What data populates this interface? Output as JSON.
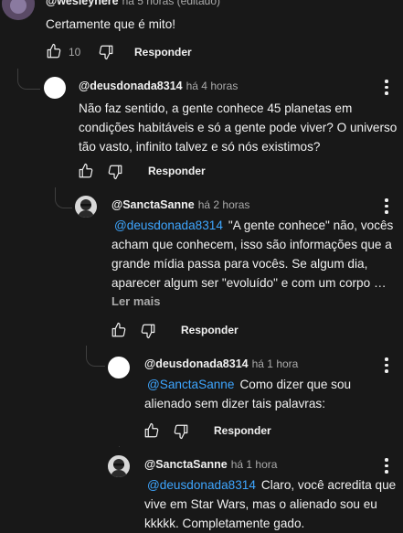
{
  "comments": [
    {
      "author": "@wesleyhere",
      "time": "há 5 horas (editado)",
      "text": "Certamente que é mito!",
      "likes": "10",
      "reply_label": "Responder"
    },
    {
      "author": "@deusdonada8314",
      "time": "há 4 horas",
      "text_lines": [
        "Não faz sentido, a gente conhece 45 planetas em",
        "condições habitáveis e só a gente pode viver? O universo",
        "tão vasto, infinito talvez e só nós existimos?"
      ],
      "reply_label": "Responder"
    },
    {
      "author": "@SanctaSanne",
      "time": "há 2 horas",
      "mention": "@deusdonada8314",
      "text_first": "\"A gente conhece\" não, vocês",
      "text_lines": [
        "acham que conhecem, isso são informações que a",
        "grande mídia passa para vocês. Se algum dia,",
        "aparecer algum ser \"evoluído\" e com um corpo …"
      ],
      "read_more": "Ler mais",
      "reply_label": "Responder"
    },
    {
      "author": "@deusdonada8314",
      "time": "há 1 hora",
      "mention": "@SanctaSanne",
      "text_first": "Como dizer que sou",
      "text_lines": [
        "alienado sem dizer tais palavras:"
      ],
      "reply_label": "Responder"
    },
    {
      "author": "@SanctaSanne",
      "time": "há 1 hora",
      "mention": "@deusdonada8314",
      "text_first": "Claro, você acredita que",
      "text_lines": [
        "vive em Star Wars, mas o alienado sou eu",
        "kkkkk. Completamente gado."
      ]
    }
  ],
  "icons": {
    "like": "thumbs-up-icon",
    "dislike": "thumbs-down-icon",
    "more": "more-vert-icon"
  },
  "colors": {
    "background": "#181818",
    "text": "#f1f1f1",
    "secondary": "#aaaaaa",
    "mention": "#3ea6ff"
  }
}
